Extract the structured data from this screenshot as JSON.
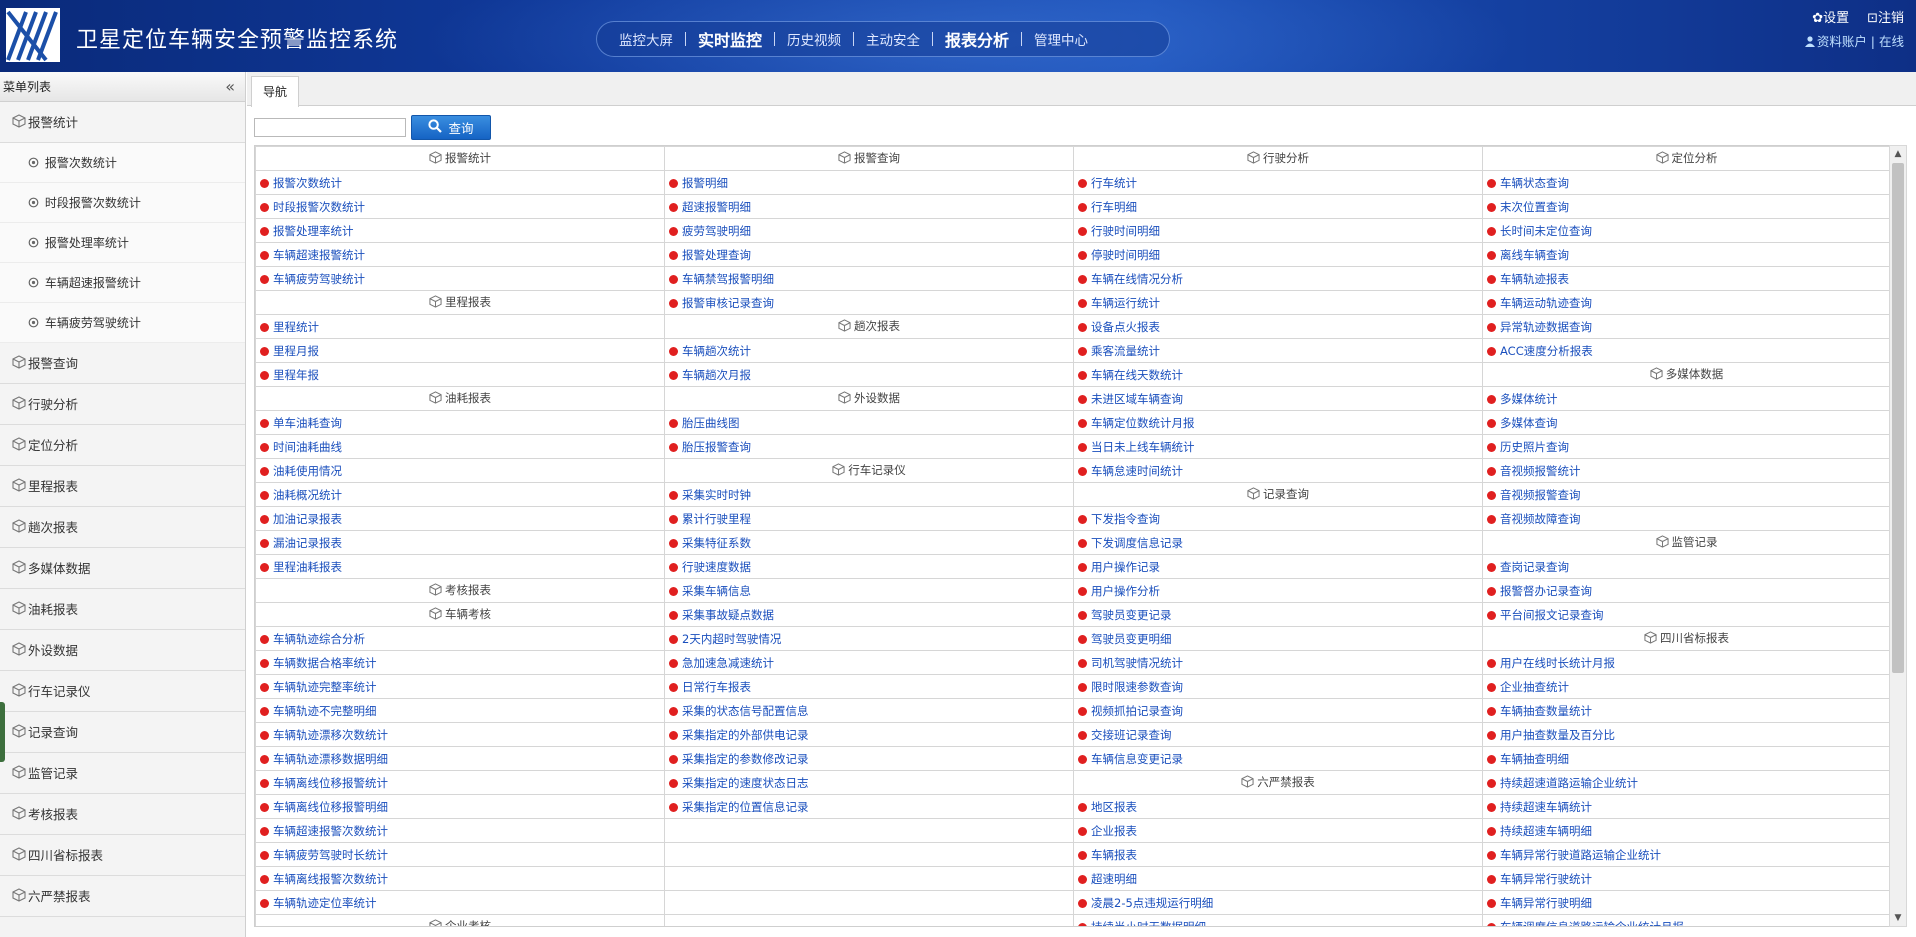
{
  "header": {
    "title": "卫星定位车辆安全预警监控系统",
    "nav": [
      {
        "label": "监控大屏",
        "bold": false
      },
      {
        "label": "实时监控",
        "bold": true
      },
      {
        "label": "历史视频",
        "bold": false
      },
      {
        "label": "主动安全",
        "bold": false
      },
      {
        "label": "报表分析",
        "bold": true
      },
      {
        "label": "管理中心",
        "bold": false
      }
    ],
    "settings_label": "✿设置",
    "logout_label": "⊡注销",
    "account_label": "资料账户 | 在线"
  },
  "sidebar": {
    "title": "菜单列表",
    "collapse_glyph": "«",
    "active_group": "报警统计",
    "active_subitems": [
      "报警次数统计",
      "时段报警次数统计",
      "报警处理率统计",
      "车辆超速报警统计",
      "车辆疲劳驾驶统计"
    ],
    "groups": [
      "报警查询",
      "行驶分析",
      "定位分析",
      "里程报表",
      "趟次报表",
      "多媒体数据",
      "油耗报表",
      "外设数据",
      "行车记录仪",
      "记录查询",
      "监管记录",
      "考核报表",
      "四川省标报表",
      "六严禁报表"
    ]
  },
  "main": {
    "tab_label": "导航",
    "search": {
      "value": "",
      "placeholder": "",
      "button_label": "查询"
    },
    "grid": [
      [
        {
          "t": "h",
          "v": "报警统计"
        },
        {
          "t": "h",
          "v": "报警查询"
        },
        {
          "t": "h",
          "v": "行驶分析"
        },
        {
          "t": "h",
          "v": "定位分析"
        }
      ],
      [
        {
          "t": "l",
          "v": "报警次数统计"
        },
        {
          "t": "l",
          "v": "报警明细"
        },
        {
          "t": "l",
          "v": "行车统计"
        },
        {
          "t": "l",
          "v": "车辆状态查询"
        }
      ],
      [
        {
          "t": "l",
          "v": "时段报警次数统计"
        },
        {
          "t": "l",
          "v": "超速报警明细"
        },
        {
          "t": "l",
          "v": "行车明细"
        },
        {
          "t": "l",
          "v": "末次位置查询"
        }
      ],
      [
        {
          "t": "l",
          "v": "报警处理率统计"
        },
        {
          "t": "l",
          "v": "疲劳驾驶明细"
        },
        {
          "t": "l",
          "v": "行驶时间明细"
        },
        {
          "t": "l",
          "v": "长时间未定位查询"
        }
      ],
      [
        {
          "t": "l",
          "v": "车辆超速报警统计"
        },
        {
          "t": "l",
          "v": "报警处理查询"
        },
        {
          "t": "l",
          "v": "停驶时间明细"
        },
        {
          "t": "l",
          "v": "离线车辆查询"
        }
      ],
      [
        {
          "t": "l",
          "v": "车辆疲劳驾驶统计"
        },
        {
          "t": "l",
          "v": "车辆禁驾报警明细"
        },
        {
          "t": "l",
          "v": "车辆在线情况分析"
        },
        {
          "t": "l",
          "v": "车辆轨迹报表"
        }
      ],
      [
        {
          "t": "h",
          "v": "里程报表"
        },
        {
          "t": "l",
          "v": "报警审核记录查询"
        },
        {
          "t": "l",
          "v": "车辆运行统计"
        },
        {
          "t": "l",
          "v": "车辆运动轨迹查询"
        }
      ],
      [
        {
          "t": "l",
          "v": "里程统计"
        },
        {
          "t": "h",
          "v": "趟次报表"
        },
        {
          "t": "l",
          "v": "设备点火报表"
        },
        {
          "t": "l",
          "v": "异常轨迹数据查询"
        }
      ],
      [
        {
          "t": "l",
          "v": "里程月报"
        },
        {
          "t": "l",
          "v": "车辆趟次统计"
        },
        {
          "t": "l",
          "v": "乘客流量统计"
        },
        {
          "t": "l",
          "v": "ACC速度分析报表"
        }
      ],
      [
        {
          "t": "l",
          "v": "里程年报"
        },
        {
          "t": "l",
          "v": "车辆趟次月报"
        },
        {
          "t": "l",
          "v": "车辆在线天数统计"
        },
        {
          "t": "h",
          "v": "多媒体数据"
        }
      ],
      [
        {
          "t": "h",
          "v": "油耗报表"
        },
        {
          "t": "h",
          "v": "外设数据"
        },
        {
          "t": "l",
          "v": "未进区域车辆查询"
        },
        {
          "t": "l",
          "v": "多媒体统计"
        }
      ],
      [
        {
          "t": "l",
          "v": "单车油耗查询"
        },
        {
          "t": "l",
          "v": "胎压曲线图"
        },
        {
          "t": "l",
          "v": "车辆定位数统计月报"
        },
        {
          "t": "l",
          "v": "多媒体查询"
        }
      ],
      [
        {
          "t": "l",
          "v": "时间油耗曲线"
        },
        {
          "t": "l",
          "v": "胎压报警查询"
        },
        {
          "t": "l",
          "v": "当日未上线车辆统计"
        },
        {
          "t": "l",
          "v": "历史照片查询"
        }
      ],
      [
        {
          "t": "l",
          "v": "油耗使用情况"
        },
        {
          "t": "h",
          "v": "行车记录仪"
        },
        {
          "t": "l",
          "v": "车辆怠速时间统计"
        },
        {
          "t": "l",
          "v": "音视频报警统计"
        }
      ],
      [
        {
          "t": "l",
          "v": "油耗概况统计"
        },
        {
          "t": "l",
          "v": "采集实时时钟"
        },
        {
          "t": "h",
          "v": "记录查询"
        },
        {
          "t": "l",
          "v": "音视频报警查询"
        }
      ],
      [
        {
          "t": "l",
          "v": "加油记录报表"
        },
        {
          "t": "l",
          "v": "累计行驶里程"
        },
        {
          "t": "l",
          "v": "下发指令查询"
        },
        {
          "t": "l",
          "v": "音视频故障查询"
        }
      ],
      [
        {
          "t": "l",
          "v": "漏油记录报表"
        },
        {
          "t": "l",
          "v": "采集特征系数"
        },
        {
          "t": "l",
          "v": "下发调度信息记录"
        },
        {
          "t": "h",
          "v": "监管记录"
        }
      ],
      [
        {
          "t": "l",
          "v": "里程油耗报表"
        },
        {
          "t": "l",
          "v": "行驶速度数据"
        },
        {
          "t": "l",
          "v": "用户操作记录"
        },
        {
          "t": "l",
          "v": "查岗记录查询"
        }
      ],
      [
        {
          "t": "h",
          "v": "考核报表"
        },
        {
          "t": "l",
          "v": "采集车辆信息"
        },
        {
          "t": "l",
          "v": "用户操作分析"
        },
        {
          "t": "l",
          "v": "报警督办记录查询"
        }
      ],
      [
        {
          "t": "h",
          "v": "车辆考核"
        },
        {
          "t": "l",
          "v": "采集事故疑点数据"
        },
        {
          "t": "l",
          "v": "驾驶员变更记录"
        },
        {
          "t": "l",
          "v": "平台间报文记录查询"
        }
      ],
      [
        {
          "t": "l",
          "v": "车辆轨迹综合分析"
        },
        {
          "t": "l",
          "v": "2天内超时驾驶情况"
        },
        {
          "t": "l",
          "v": "驾驶员变更明细"
        },
        {
          "t": "h",
          "v": "四川省标报表"
        }
      ],
      [
        {
          "t": "l",
          "v": "车辆数据合格率统计"
        },
        {
          "t": "l",
          "v": "急加速急减速统计"
        },
        {
          "t": "l",
          "v": "司机驾驶情况统计"
        },
        {
          "t": "l",
          "v": "用户在线时长统计月报"
        }
      ],
      [
        {
          "t": "l",
          "v": "车辆轨迹完整率统计"
        },
        {
          "t": "l",
          "v": "日常行车报表"
        },
        {
          "t": "l",
          "v": "限时限速参数查询"
        },
        {
          "t": "l",
          "v": "企业抽查统计"
        }
      ],
      [
        {
          "t": "l",
          "v": "车辆轨迹不完整明细"
        },
        {
          "t": "l",
          "v": "采集的状态信号配置信息"
        },
        {
          "t": "l",
          "v": "视频抓拍记录查询"
        },
        {
          "t": "l",
          "v": "车辆抽查数量统计"
        }
      ],
      [
        {
          "t": "l",
          "v": "车辆轨迹漂移次数统计"
        },
        {
          "t": "l",
          "v": "采集指定的外部供电记录"
        },
        {
          "t": "l",
          "v": "交接班记录查询"
        },
        {
          "t": "l",
          "v": "用户抽查数量及百分比"
        }
      ],
      [
        {
          "t": "l",
          "v": "车辆轨迹漂移数据明细"
        },
        {
          "t": "l",
          "v": "采集指定的参数修改记录"
        },
        {
          "t": "l",
          "v": "车辆信息变更记录"
        },
        {
          "t": "l",
          "v": "车辆抽查明细"
        }
      ],
      [
        {
          "t": "l",
          "v": "车辆离线位移报警统计"
        },
        {
          "t": "l",
          "v": "采集指定的速度状态日志"
        },
        {
          "t": "h",
          "v": "六严禁报表"
        },
        {
          "t": "l",
          "v": "持续超速道路运输企业统计"
        }
      ],
      [
        {
          "t": "l",
          "v": "车辆离线位移报警明细"
        },
        {
          "t": "l",
          "v": "采集指定的位置信息记录"
        },
        {
          "t": "l",
          "v": "地区报表"
        },
        {
          "t": "l",
          "v": "持续超速车辆统计"
        }
      ],
      [
        {
          "t": "l",
          "v": "车辆超速报警次数统计"
        },
        {
          "t": "e",
          "v": ""
        },
        {
          "t": "l",
          "v": "企业报表"
        },
        {
          "t": "l",
          "v": "持续超速车辆明细"
        }
      ],
      [
        {
          "t": "l",
          "v": "车辆疲劳驾驶时长统计"
        },
        {
          "t": "e",
          "v": ""
        },
        {
          "t": "l",
          "v": "车辆报表"
        },
        {
          "t": "l",
          "v": "车辆异常行驶道路运输企业统计"
        }
      ],
      [
        {
          "t": "l",
          "v": "车辆离线报警次数统计"
        },
        {
          "t": "e",
          "v": ""
        },
        {
          "t": "l",
          "v": "超速明细"
        },
        {
          "t": "l",
          "v": "车辆异常行驶统计"
        }
      ],
      [
        {
          "t": "l",
          "v": "车辆轨迹定位率统计"
        },
        {
          "t": "e",
          "v": ""
        },
        {
          "t": "l",
          "v": "凌晨2-5点违规运行明细"
        },
        {
          "t": "l",
          "v": "车辆异常行驶明细"
        }
      ],
      [
        {
          "t": "h",
          "v": "企业考核"
        },
        {
          "t": "e",
          "v": ""
        },
        {
          "t": "l",
          "v": "持续半小时无数据明细"
        },
        {
          "t": "l",
          "v": "车辆调度信息道路运输企业统计月报"
        }
      ]
    ]
  }
}
